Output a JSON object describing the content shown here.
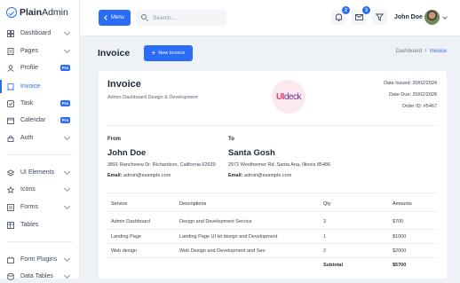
{
  "brand": {
    "name_bold": "Plain",
    "name_regular": "Admin"
  },
  "sidebar": {
    "items": [
      {
        "label": "Dashboard",
        "has_chevron": true,
        "pro": false
      },
      {
        "label": "Pages",
        "has_chevron": true,
        "pro": false
      },
      {
        "label": "Profile",
        "has_chevron": false,
        "pro": true
      },
      {
        "label": "Invoice",
        "has_chevron": false,
        "pro": false,
        "active": true
      },
      {
        "label": "Task",
        "has_chevron": false,
        "pro": true
      },
      {
        "label": "Calendar",
        "has_chevron": false,
        "pro": true
      },
      {
        "label": "Auth",
        "has_chevron": true,
        "pro": false
      },
      {
        "label": "UI Elements",
        "has_chevron": true,
        "pro": false
      },
      {
        "label": "Icons",
        "has_chevron": true,
        "pro": false
      },
      {
        "label": "Forms",
        "has_chevron": true,
        "pro": false
      },
      {
        "label": "Tables",
        "has_chevron": false,
        "pro": false
      },
      {
        "label": "Form Plugins",
        "has_chevron": true,
        "pro": false
      },
      {
        "label": "Data Tables",
        "has_chevron": true,
        "pro": false
      }
    ],
    "pro_label": "Pro"
  },
  "topbar": {
    "menu_label": "Menu",
    "search_placeholder": "Search...",
    "notifications_count": "2",
    "messages_count": "3",
    "user_name": "John Doe"
  },
  "page": {
    "title": "Invoice",
    "new_button_label": "New Invoice",
    "breadcrumb": {
      "parent": "Dashboard",
      "separator": "/",
      "current": "Invoice"
    }
  },
  "invoice": {
    "title": "Invoice",
    "subtitle": "Admin Dashboard Design & Development",
    "logo_left": "UI",
    "logo_right": "deck",
    "date_issued": "Date Issued: 20/02/2024",
    "date_due": "Date Due: 20/02/2028",
    "order_id": "Order ID: #5467",
    "from": {
      "label": "From",
      "name": "John Doe",
      "address": "3891 Ranchview Dr. Richardson, California 62639",
      "email_label": "Email:",
      "email": "admin@example.com"
    },
    "to": {
      "label": "To",
      "name": "Santa Gosh",
      "address": "2972 Westheimer Rd. Santa Ana, Illinois 85486",
      "email_label": "Email:",
      "email": "admin@example.com"
    },
    "table": {
      "headers": [
        "Service",
        "Descriptions",
        "Qty",
        "Amounts"
      ],
      "rows": [
        [
          "Admin Dashboard",
          "Design and Development Service",
          "3",
          "$700"
        ],
        [
          "Landing Page",
          "Landing Page UI kit design and Development",
          "1",
          "$1000"
        ],
        [
          "Web design",
          "Web Design and Development and Seo",
          "2",
          "$2000"
        ]
      ],
      "subtotal_label": "Subtotal",
      "subtotal_value": "$5700"
    }
  },
  "colors": {
    "accent": "#2b6cf6",
    "background": "#eef2f7"
  }
}
